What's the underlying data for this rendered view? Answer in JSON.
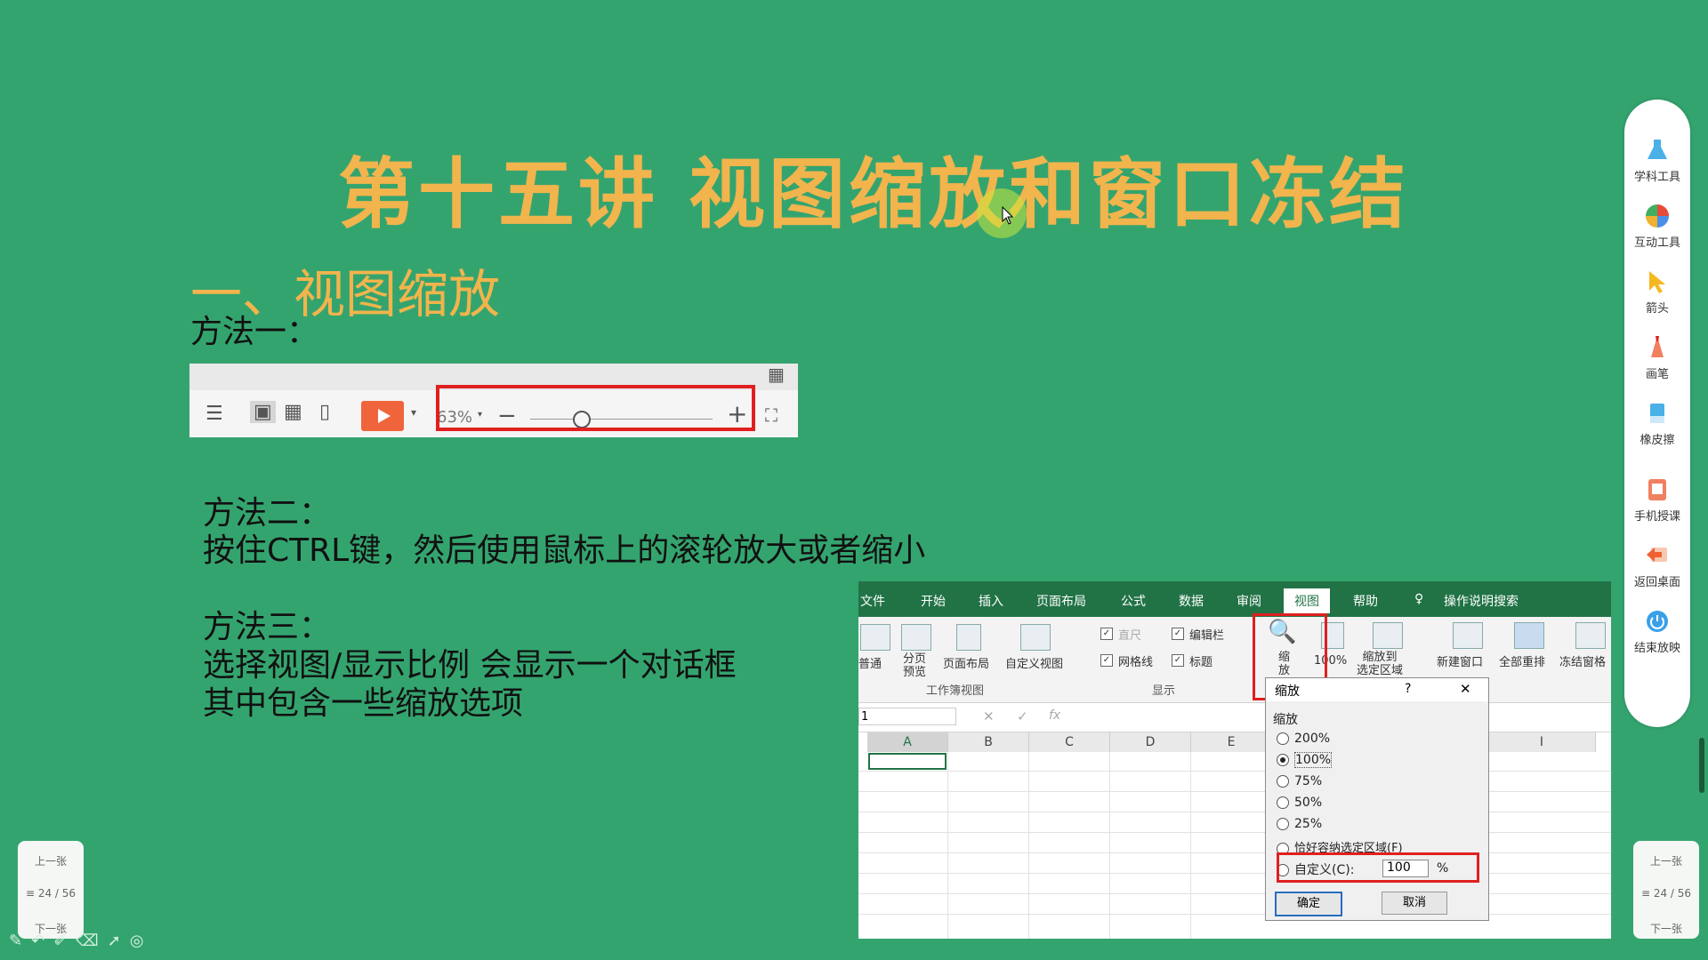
{
  "slide": {
    "title": "第十五讲 视图缩放和窗口冻结",
    "section": "一、视图缩放",
    "method1_label": "方法一：",
    "method2_label": "方法二：",
    "method2_text": "按住CTRL键，然后使用鼠标上的滚轮放大或者缩小",
    "method3_label": "方法三：",
    "method3_line1": "选择视图/显示比例 会显示一个对话框",
    "method3_line2": "其中包含一些缩放选项"
  },
  "toolbar1": {
    "zoom_value": "63%",
    "minus": "−",
    "plus": "+",
    "zoom_level_percent": 63
  },
  "excel": {
    "tabs": [
      "文件",
      "开始",
      "插入",
      "页面布局",
      "公式",
      "数据",
      "审阅",
      "视图",
      "帮助",
      "操作说明搜索"
    ],
    "active_tab": "视图",
    "ribbon": {
      "normal": "普通",
      "page_break": "分页\n预览",
      "page_layout": "页面布局",
      "custom_view": "自定义视图",
      "ruler": "直尺",
      "formula_bar": "编辑栏",
      "gridlines": "网格线",
      "headings": "标题",
      "zoom": "缩\n放",
      "hundred": "100%",
      "zoom_to_selection": "缩放到\n选定区域",
      "new_window": "新建窗口",
      "arrange_all": "全部重排",
      "freeze_panes": "冻结窗格",
      "group_workbook_views": "工作簿视图",
      "group_show": "显示"
    },
    "name_box": "1",
    "columns": [
      "A",
      "B",
      "C",
      "D",
      "E",
      "I"
    ],
    "dialog": {
      "title": "缩放",
      "help": "?",
      "close": "✕",
      "group": "缩放",
      "options": [
        "200%",
        "100%",
        "75%",
        "50%",
        "25%",
        "恰好容纳选定区域(F)"
      ],
      "selected": "100%",
      "custom_label": "自定义(C):",
      "custom_value": "100",
      "percent": "%",
      "ok": "确定",
      "cancel": "取消"
    }
  },
  "right_tools": [
    "学科工具",
    "互动工具",
    "箭头",
    "画笔",
    "橡皮擦",
    "手机授课",
    "返回桌面",
    "结束放映"
  ],
  "nav": {
    "prev": "上一张",
    "page": "24 / 56",
    "next": "下一张"
  },
  "colors": {
    "background": "#34a46f",
    "title": "#f2b44c",
    "highlight_box": "#e02020",
    "excel_green": "#217346"
  }
}
